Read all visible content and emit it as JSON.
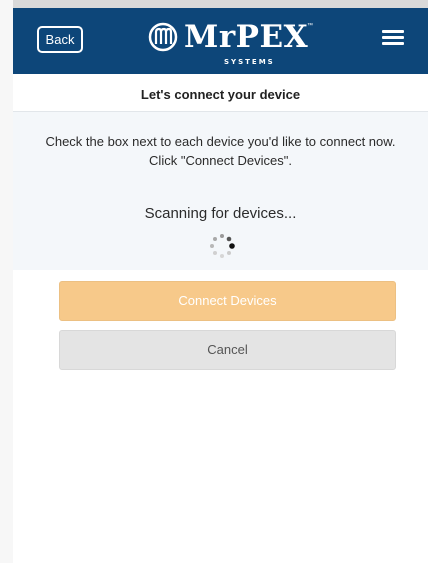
{
  "header": {
    "back_label": "Back",
    "logo_text": "MrPEX",
    "logo_tm": "™",
    "logo_subtitle": "SYSTEMS",
    "brand_color": "#0d4679"
  },
  "page": {
    "title": "Let's connect your device",
    "instructions_line1": "Check the box next to each device you'd like to connect now.",
    "instructions_line2": "Click \"Connect Devices\".",
    "scanning_text": "Scanning for devices..."
  },
  "actions": {
    "connect_label": "Connect Devices",
    "connect_state": "disabled",
    "connect_color": "#f7c98a",
    "cancel_label": "Cancel",
    "cancel_color": "#e4e4e4"
  },
  "icons": {
    "logo": "mrpex-logo-icon",
    "menu": "hamburger-menu-icon",
    "spinner": "loading-spinner-icon"
  }
}
